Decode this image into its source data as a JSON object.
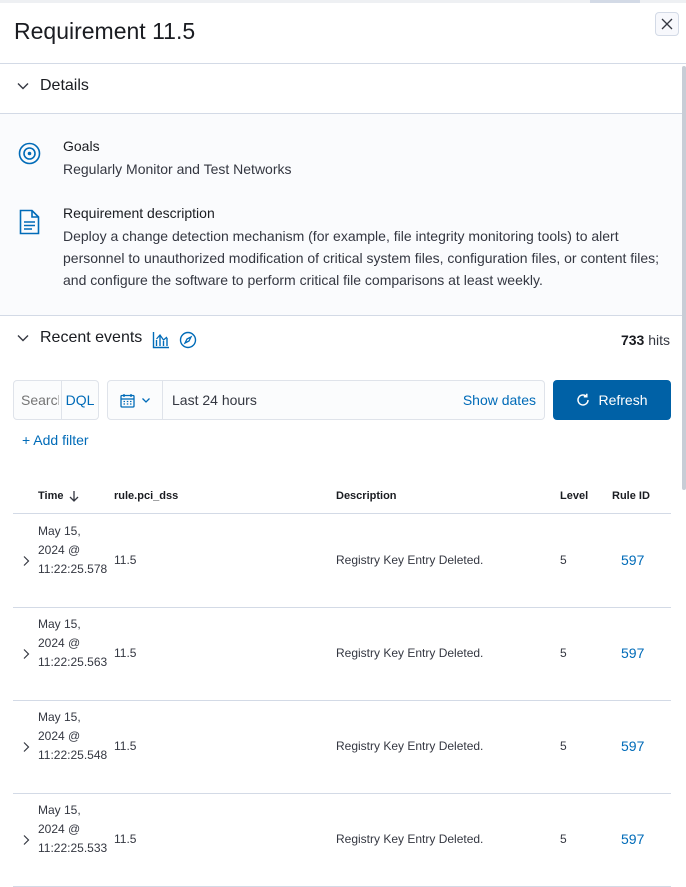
{
  "flyout": {
    "title": "Requirement 11.5",
    "close_label": "Close"
  },
  "details": {
    "heading": "Details",
    "goals_label": "Goals",
    "goals_value": "Regularly Monitor and Test Networks",
    "description_label": "Requirement description",
    "description_value": "Deploy a change detection mechanism (for example, file integrity monitoring tools) to alert personnel to unauthorized modification of critical system files, configuration files, or content files; and configure the software to perform critical file comparisons at least weekly."
  },
  "events": {
    "heading": "Recent events",
    "hits_count": "733",
    "hits_label": "hits"
  },
  "search": {
    "placeholder": "Search",
    "language": "DQL"
  },
  "date_picker": {
    "range": "Last 24 hours",
    "show_dates": "Show dates"
  },
  "refresh_label": "Refresh",
  "add_filter_label": "+ Add filter",
  "table": {
    "columns": [
      "Time",
      "rule.pci_dss",
      "Description",
      "Level",
      "Rule ID"
    ],
    "rows": [
      {
        "time": "May 15, 2024 @ 11:22:25.578",
        "pci": "11.5",
        "description": "Registry Key Entry Deleted.",
        "level": "5",
        "rule_id": "597"
      },
      {
        "time": "May 15, 2024 @ 11:22:25.563",
        "pci": "11.5",
        "description": "Registry Key Entry Deleted.",
        "level": "5",
        "rule_id": "597"
      },
      {
        "time": "May 15, 2024 @ 11:22:25.548",
        "pci": "11.5",
        "description": "Registry Key Entry Deleted.",
        "level": "5",
        "rule_id": "597"
      },
      {
        "time": "May 15, 2024 @ 11:22:25.533",
        "pci": "11.5",
        "description": "Registry Key Entry Deleted.",
        "level": "5",
        "rule_id": "597"
      }
    ]
  },
  "colors": {
    "link": "#006bb8",
    "primary_button": "#0061a6",
    "border": "#d3dae6"
  }
}
